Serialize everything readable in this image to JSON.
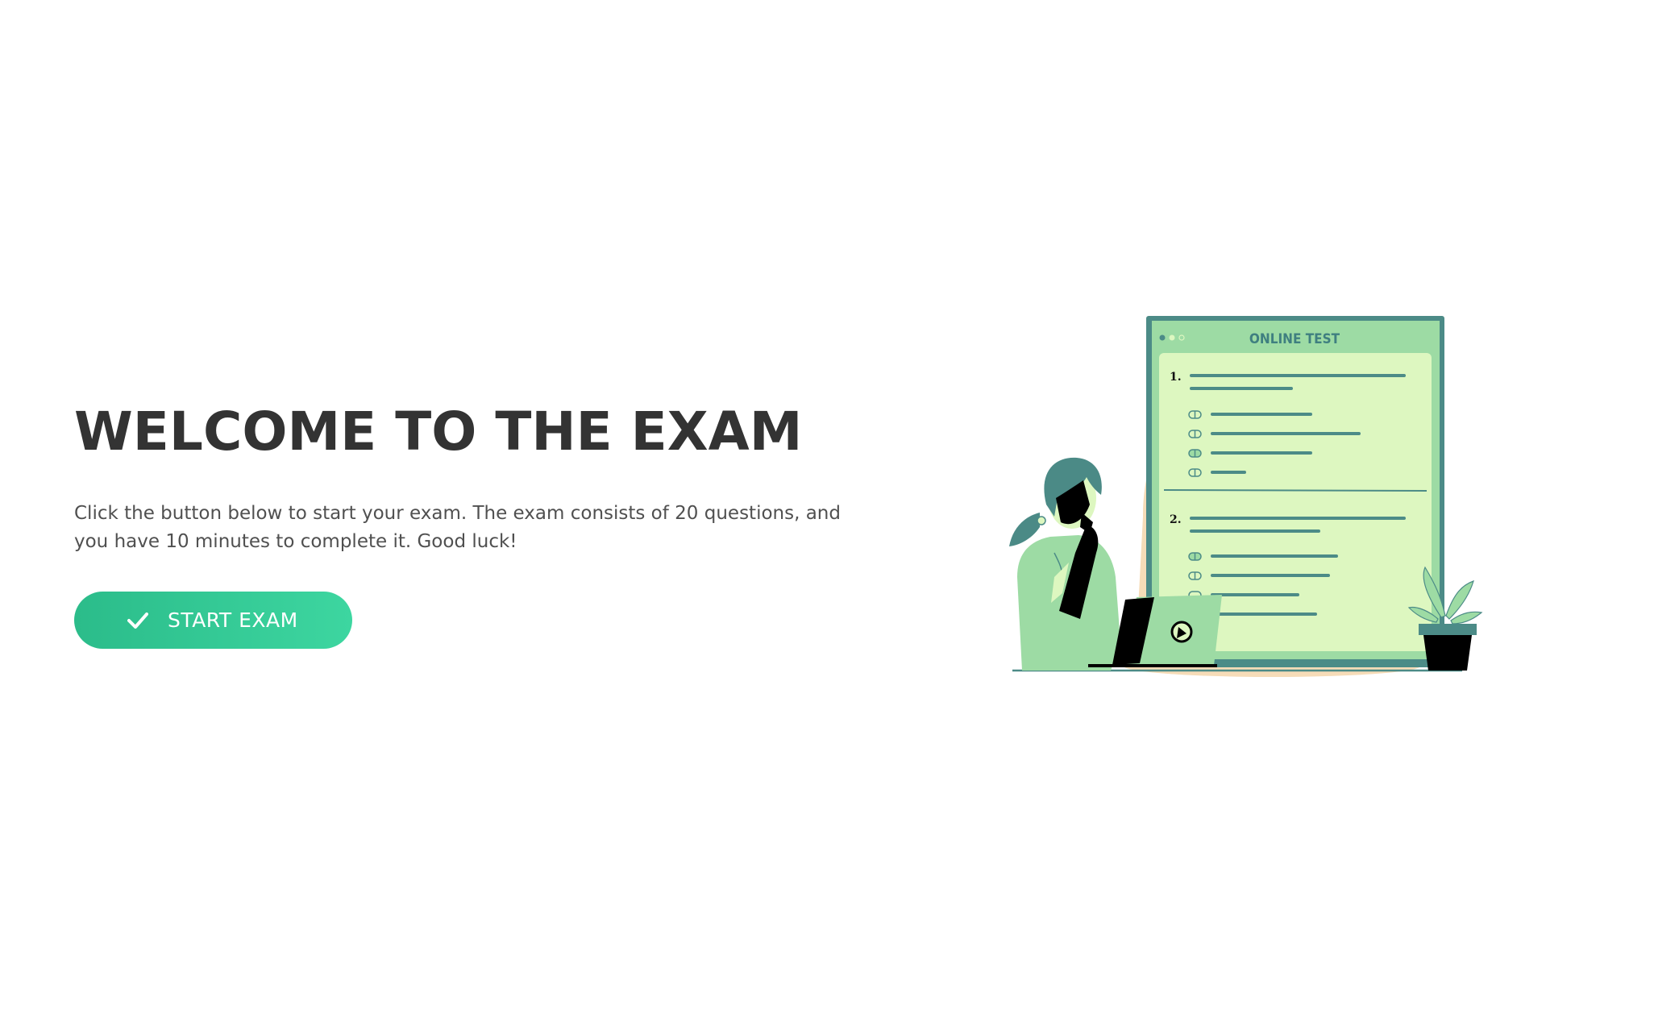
{
  "welcome": {
    "title": "WELCOME TO THE EXAM",
    "description": "Click the button below to start your exam. The exam consists of 20 questions, and you have 10 minutes to complete it. Good luck!",
    "start_button_label": "START EXAM",
    "start_button_icon": "check-icon"
  },
  "illustration": {
    "screen_title": "ONLINE TEST",
    "question_numbers": [
      "1.",
      "2."
    ],
    "colors": {
      "accent": "#2bbc8a",
      "frame": "#4c8b87",
      "screen_light": "#ddf7c0",
      "screen_mid": "#9ddba4",
      "blob": "#f6dcb8",
      "hair": "#4b8a86",
      "ink": "#000000"
    }
  }
}
